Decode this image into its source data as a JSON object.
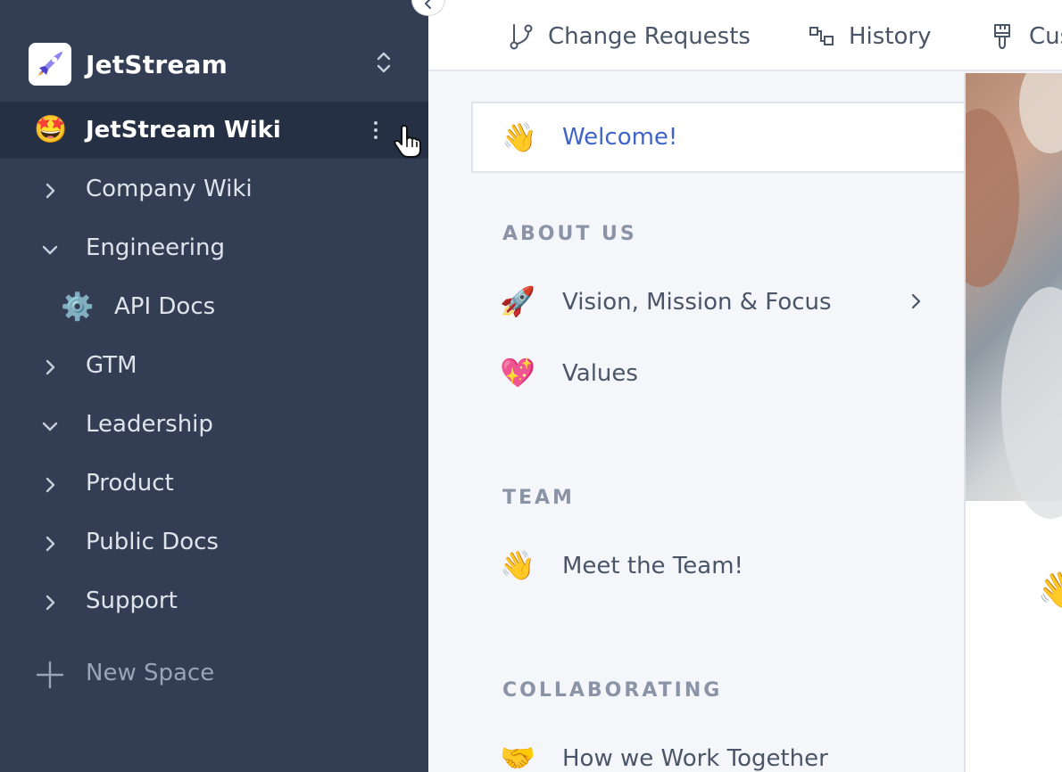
{
  "sidebar": {
    "org_name": "JetStream",
    "org_logo_icon": "rocket-logo-icon",
    "active_space": {
      "emoji": "🤩",
      "label": "JetStream Wiki"
    },
    "items": [
      {
        "label": "Company Wiki",
        "expanded": false
      },
      {
        "label": "Engineering",
        "expanded": true
      },
      {
        "label": "API Docs",
        "emoji": "⚙️",
        "sub": true
      },
      {
        "label": "GTM",
        "expanded": false
      },
      {
        "label": "Leadership",
        "expanded": true
      },
      {
        "label": "Product",
        "expanded": false
      },
      {
        "label": "Public Docs",
        "expanded": false
      },
      {
        "label": "Support",
        "expanded": false
      }
    ],
    "new_space_label": "New Space"
  },
  "topbar": {
    "tabs": [
      {
        "label": "Change Requests",
        "icon": "branch-icon"
      },
      {
        "label": "History",
        "icon": "history-icon"
      },
      {
        "label": "Cus",
        "icon": "brush-icon"
      }
    ]
  },
  "content": {
    "welcome": {
      "emoji": "👋",
      "label": "Welcome!"
    },
    "sections": [
      {
        "title": "ABOUT US",
        "items": [
          {
            "emoji": "🚀",
            "label": "Vision, Mission & Focus",
            "has_children": true
          },
          {
            "emoji": "💖",
            "label": "Values"
          }
        ]
      },
      {
        "title": "TEAM",
        "items": [
          {
            "emoji": "👋",
            "label": "Meet the Team!"
          }
        ]
      },
      {
        "title": "COLLABORATING",
        "items": [
          {
            "emoji": "🤝",
            "label": "How we Work Together"
          }
        ]
      }
    ]
  },
  "preview": {
    "emoji": "👋"
  },
  "colors": {
    "sidebar_bg": "#333e55",
    "active_bg": "#263044",
    "link": "#3f63c9"
  }
}
